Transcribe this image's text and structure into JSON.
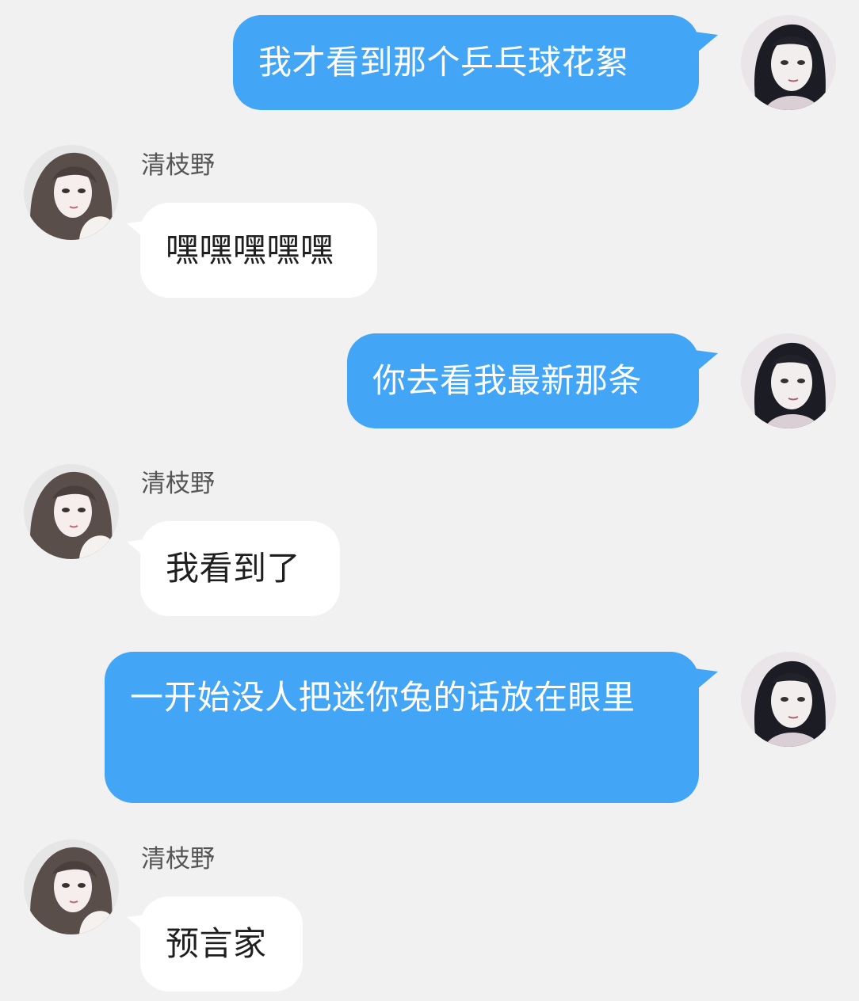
{
  "messages": [
    {
      "side": "out",
      "text": "我才看到那个乒乓球花絮"
    },
    {
      "side": "in",
      "sender": "清枝野",
      "text": "嘿嘿嘿嘿嘿"
    },
    {
      "side": "out",
      "text": "你去看我最新那条"
    },
    {
      "side": "in",
      "sender": "清枝野",
      "text": "我看到了"
    },
    {
      "side": "out",
      "text": "一开始没人把迷你兔的话放在眼里"
    },
    {
      "side": "in",
      "sender": "清枝野",
      "text": "预言家"
    }
  ],
  "colors": {
    "background": "#f1f1f1",
    "outgoing_bubble": "#42a5f5",
    "incoming_bubble": "#ffffff",
    "sender_name": "#555555"
  },
  "icons": {
    "self_avatar": "avatar-icon",
    "contact_avatar": "avatar-icon"
  }
}
